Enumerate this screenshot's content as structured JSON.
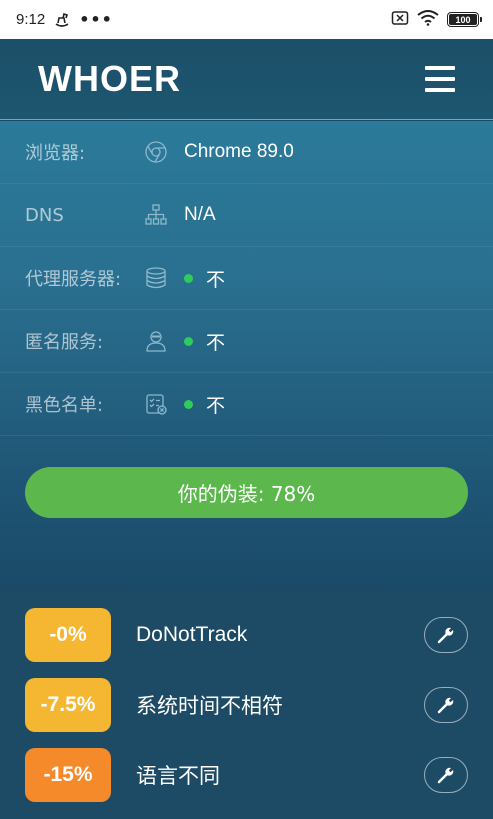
{
  "status_bar": {
    "time": "9:12",
    "dots": "•••",
    "battery": "100"
  },
  "header": {
    "logo": "WHOER"
  },
  "info_rows": [
    {
      "label": "浏览器:",
      "icon": "browser-icon",
      "value": "Chrome 89.0",
      "dot": false
    },
    {
      "label": "DNS",
      "icon": "network-icon",
      "value": "N/A",
      "dot": false
    },
    {
      "label": "代理服务器:",
      "icon": "database-icon",
      "value": "不",
      "dot": true
    },
    {
      "label": "匿名服务:",
      "icon": "anonymous-icon",
      "value": "不",
      "dot": true
    },
    {
      "label": "黑色名单:",
      "icon": "blacklist-icon",
      "value": "不",
      "dot": true
    }
  ],
  "disguise": {
    "label": "你的伪装: 78%",
    "percent": 78
  },
  "issues": [
    {
      "badge": "-0%",
      "label": "DoNotTrack",
      "color": "#f5b731"
    },
    {
      "badge": "-7.5%",
      "label": "系统时间不相符",
      "color": "#f5b731"
    },
    {
      "badge": "-15%",
      "label": "语言不同",
      "color": "#f58a2a"
    }
  ],
  "colors": {
    "dot_green": "#2ecc5a",
    "disguise_green": "#5cb84c"
  }
}
